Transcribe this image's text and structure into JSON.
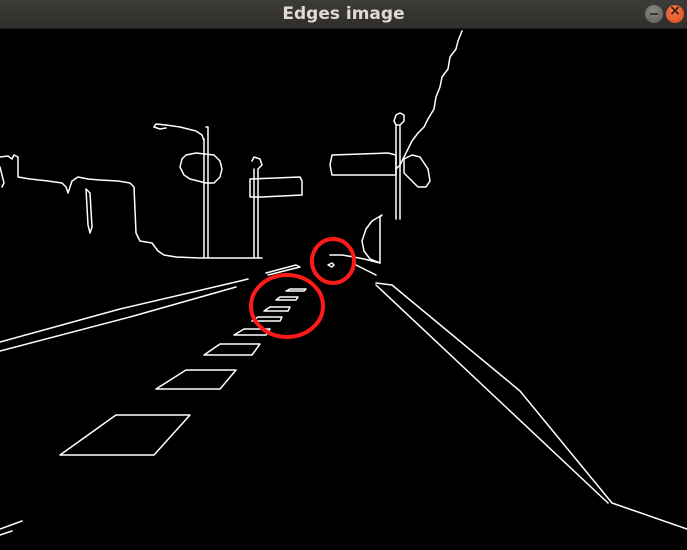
{
  "window": {
    "title": "Edges image",
    "buttons": {
      "minimize_icon": "minimize-icon",
      "close_icon": "close-icon",
      "close_glyph": "×"
    }
  },
  "image": {
    "background_color": "#000000",
    "edge_color": "#ffffff",
    "annotation_color": "#ff1a1a",
    "annotations": [
      "small-circle-marker",
      "large-circle-marker"
    ]
  }
}
